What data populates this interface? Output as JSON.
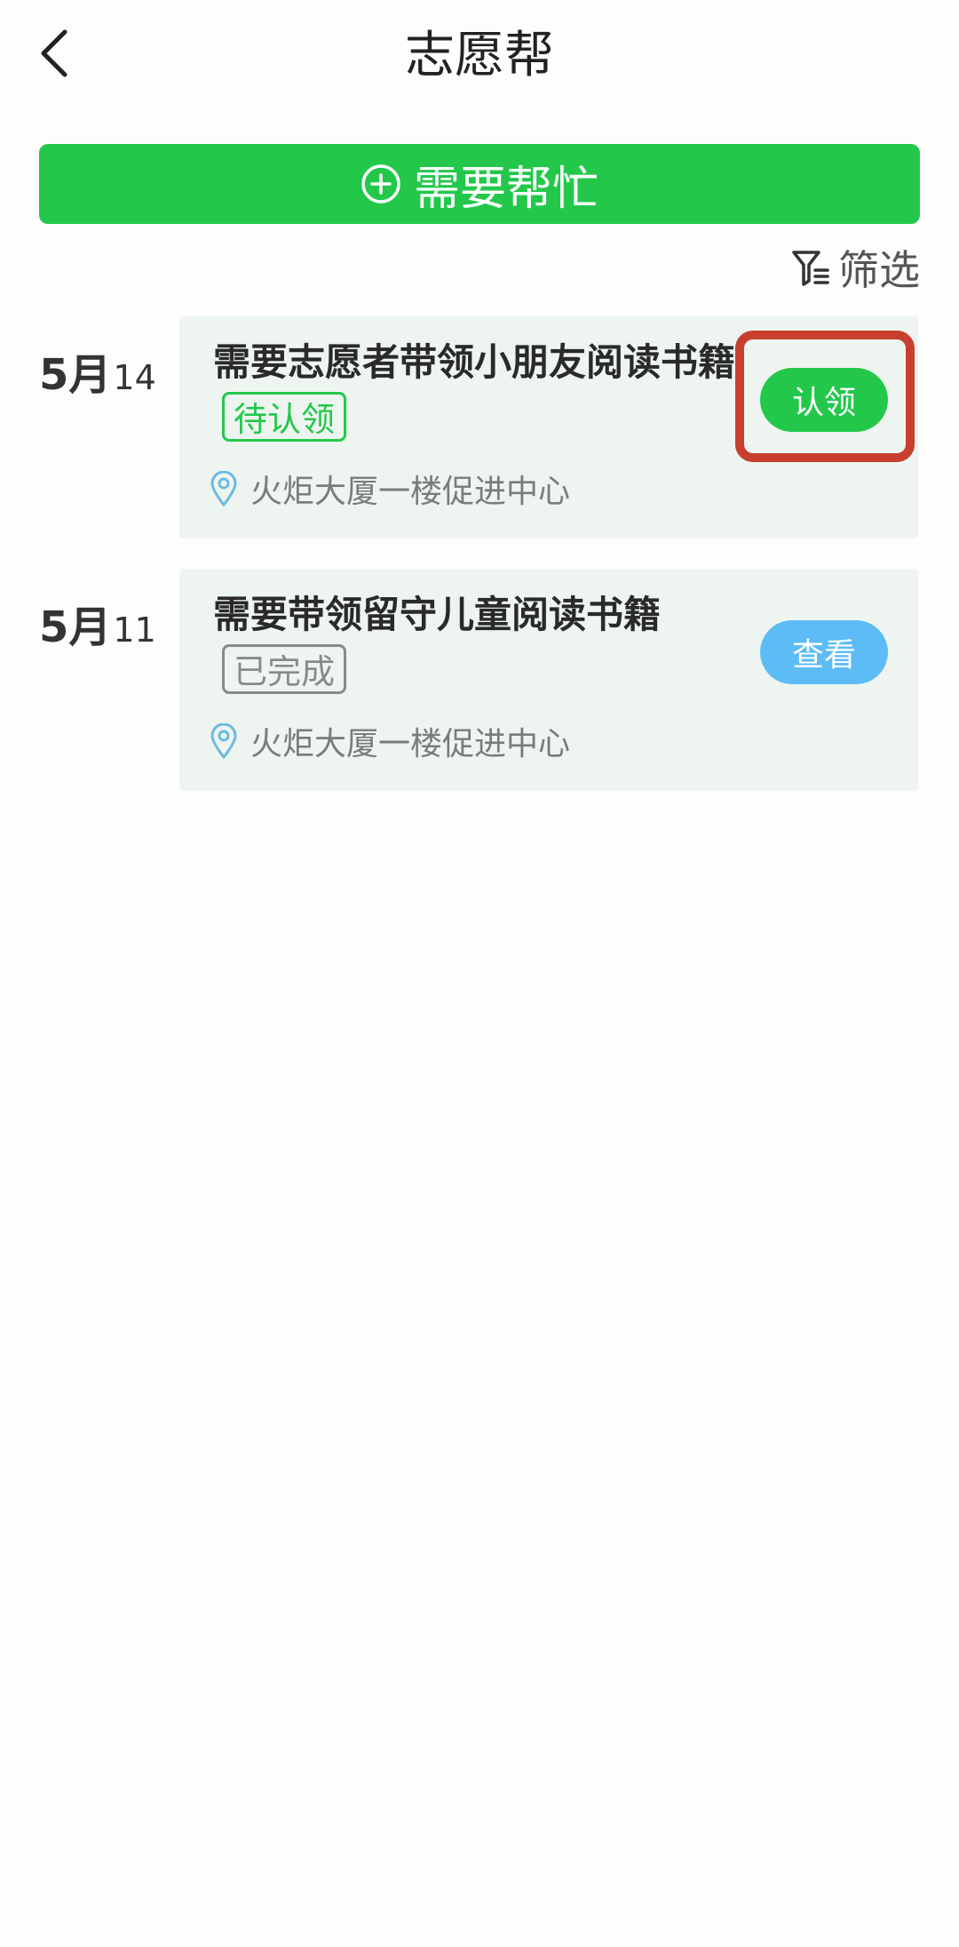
{
  "header": {
    "title": "志愿帮",
    "back_icon": "chevron-left-icon"
  },
  "help_button": {
    "label": "需要帮忙",
    "icon": "plus-circle-icon"
  },
  "filter": {
    "label": "筛选",
    "icon": "funnel-icon"
  },
  "items": [
    {
      "date_month": "5月",
      "date_day": "14",
      "title": "需要志愿者带领小朋友阅读书籍",
      "status": "待认领",
      "location": "火炬大厦一楼促进中心",
      "action": "认领"
    },
    {
      "date_month": "5月",
      "date_day": "11",
      "title": "需要带领留守儿童阅读书籍",
      "status": "已完成",
      "location": "火炬大厦一楼促进中心",
      "action": "查看"
    }
  ],
  "colors": {
    "primary_green": "#23c84b",
    "view_blue": "#5dbcf5",
    "card_bg": "#eef5f0",
    "highlight_red": "#c83f2f",
    "pin_blue": "#6bbbe0"
  }
}
